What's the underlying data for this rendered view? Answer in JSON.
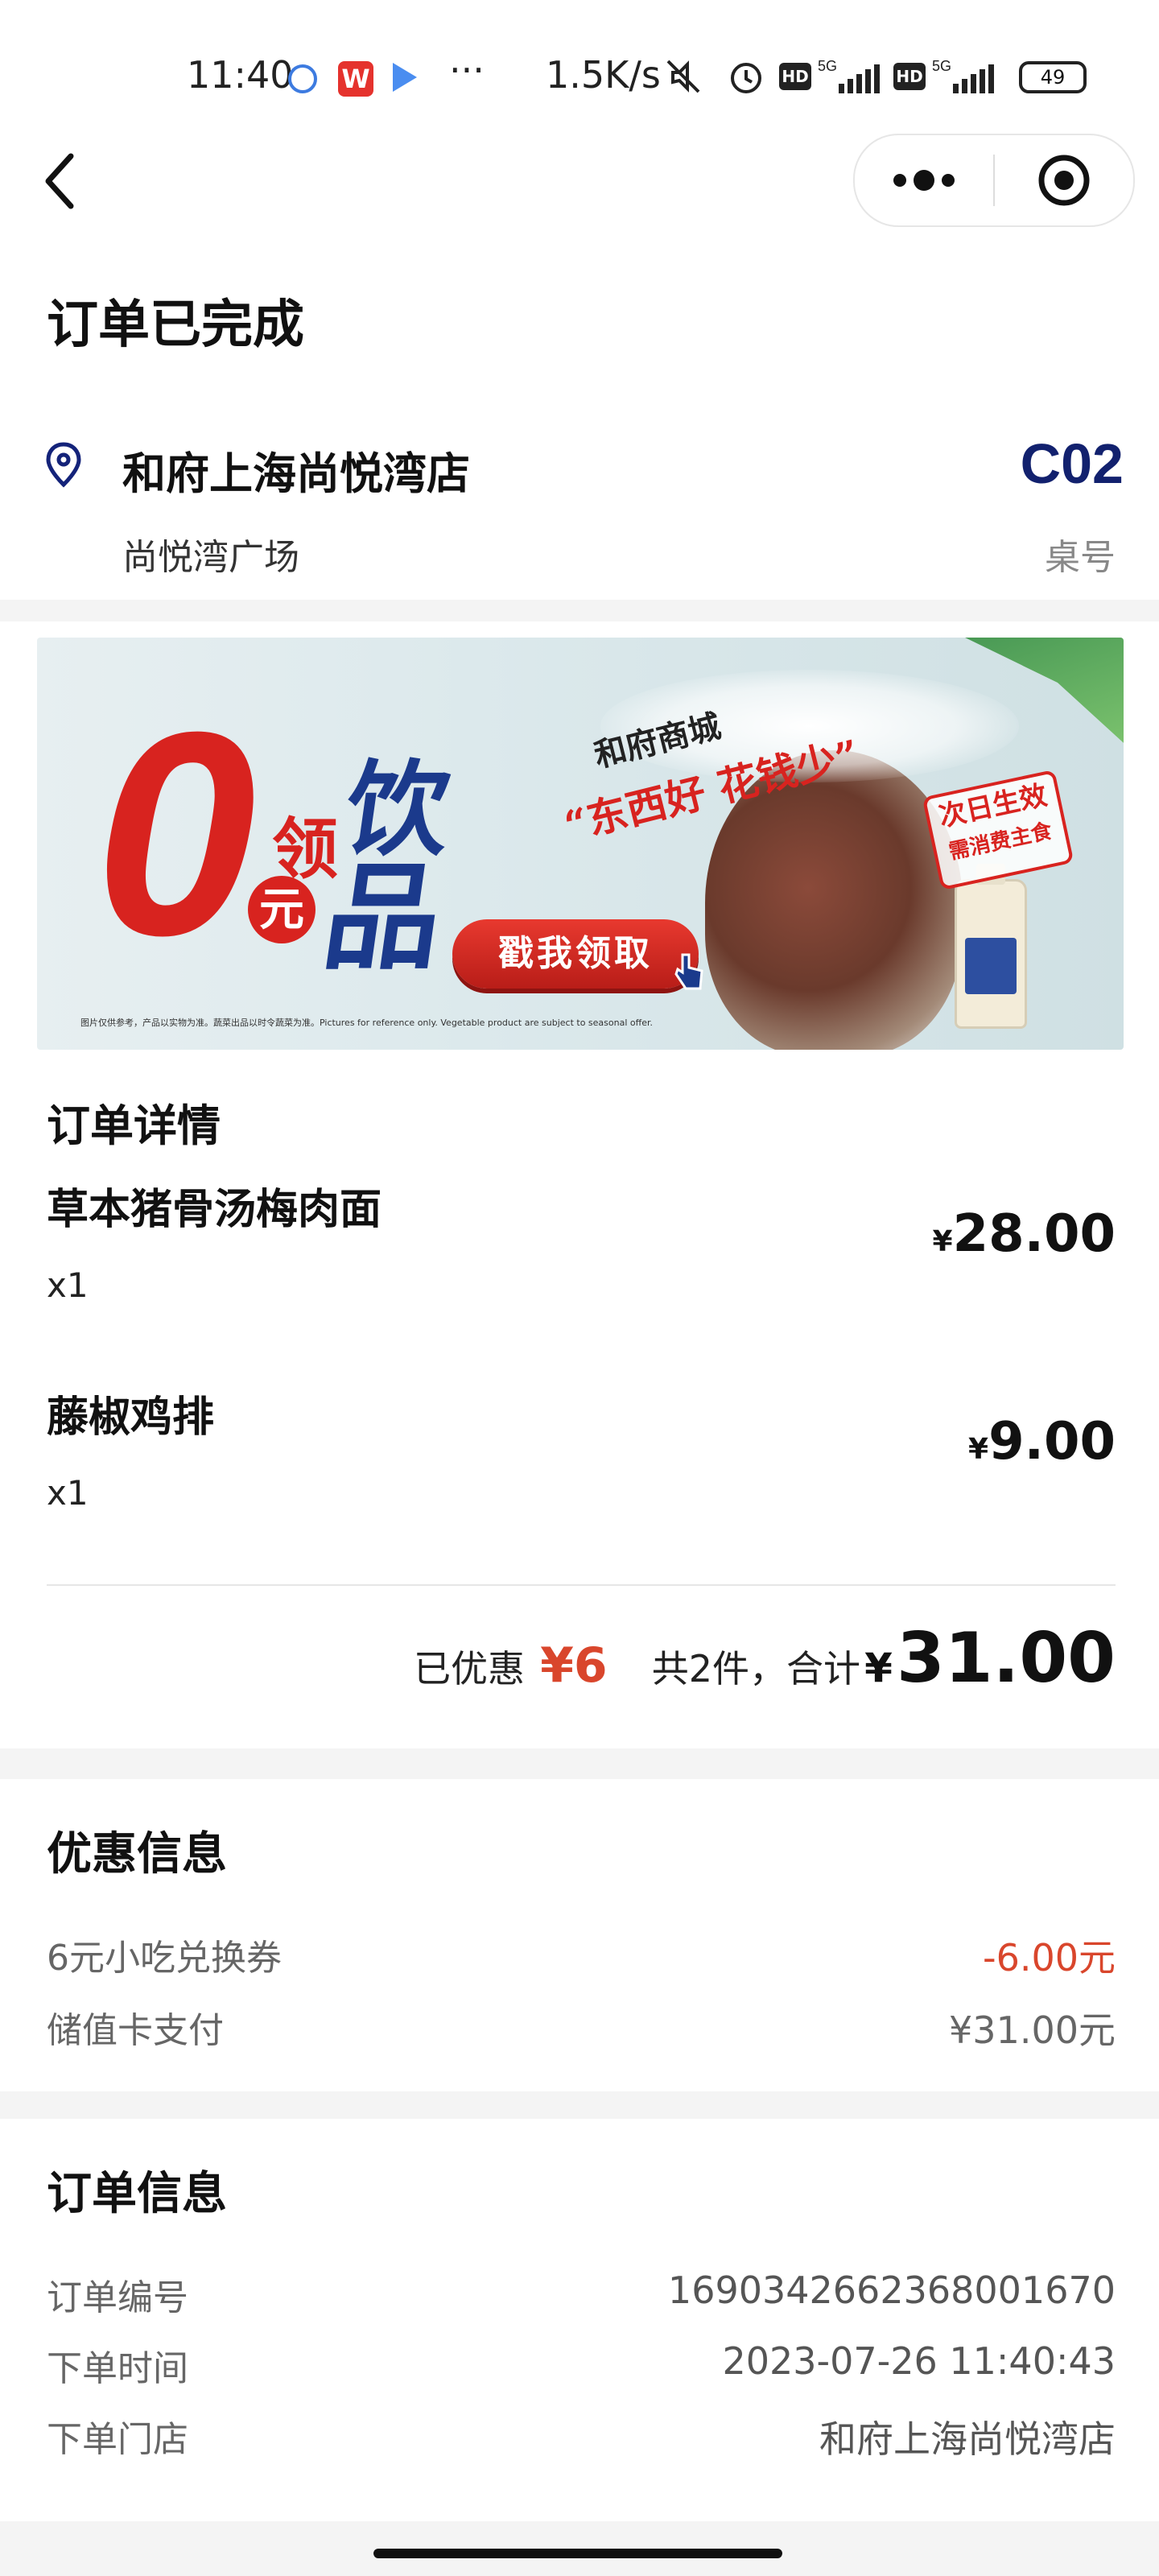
{
  "status_bar": {
    "time": "11:40",
    "net_speed": "1.5K/s",
    "battery": "49"
  },
  "header": {
    "title": "订单已完成"
  },
  "store": {
    "name": "和府上海尚悦湾店",
    "address": "尚悦湾广场",
    "table_number": "C02",
    "table_label": "桌号"
  },
  "banner": {
    "big_zero": "0",
    "ling": "领",
    "yuan": "元",
    "yin": "饮",
    "pin": "品",
    "mall": "和府商城",
    "slogan": "“东西好 花钱少”",
    "cta": "戳我领取",
    "badge_line1": "次日生效",
    "badge_line2": "需消费主食",
    "disclaimer": "图片仅供参考，产品以实物为准。蔬菜出品以时令蔬菜为准。Pictures for reference only. Vegetable product are subject to seasonal offer."
  },
  "order_detail": {
    "title": "订单详情",
    "items": [
      {
        "name": "草本猪骨汤梅肉面",
        "qty": "x1",
        "currency": "¥",
        "price": "28.00"
      },
      {
        "name": "藤椒鸡排",
        "qty": "x1",
        "currency": "¥",
        "price": "9.00"
      }
    ],
    "discount_label": "已优惠",
    "discount_amount": "¥6",
    "count_label": "共2件，合计",
    "total_currency": "¥",
    "total_amount": "31.00"
  },
  "promo_info": {
    "title": "优惠信息",
    "rows": [
      {
        "label": "6元小吃兑换券",
        "value": "-6.00元"
      },
      {
        "label": "储值卡支付",
        "value": "¥31.00元"
      }
    ]
  },
  "order_info": {
    "title": "订单信息",
    "rows": [
      {
        "label": "订单编号",
        "value": "1690342662368001670"
      },
      {
        "label": "下单时间",
        "value": "2023-07-26 11:40:43"
      },
      {
        "label": "下单门店",
        "value": "和府上海尚悦湾店"
      }
    ]
  },
  "colors": {
    "accent_red": "#d9462c",
    "table_blue": "#12216e",
    "banner_red": "#d8231f",
    "banner_blue": "#1b3a8c"
  }
}
